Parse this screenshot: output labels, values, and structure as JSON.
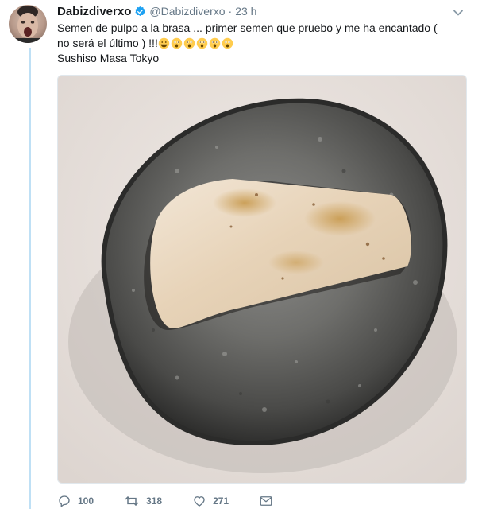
{
  "tweet": {
    "display_name": "Dabizdiverxo",
    "handle": "@Dabizdiverxo",
    "separator": "·",
    "time": "23 h",
    "text_line1": "Semen de pulpo a la brasa ... primer semen que pruebo y me ha encantado (",
    "text_line2": "no será el último ) !!!",
    "location_line": "Sushiso Masa Tokyo",
    "emojis": [
      "grinning-face-emoji",
      "astonished-face-emoji",
      "astonished-face-emoji",
      "astonished-face-emoji",
      "astonished-face-emoji",
      "astonished-face-emoji"
    ]
  },
  "actions": {
    "reply_count": "100",
    "retweet_count": "318",
    "like_count": "271"
  },
  "icons": {
    "verified": "verified-badge-icon",
    "caret": "chevron-down-icon",
    "reply": "reply-icon",
    "retweet": "retweet-icon",
    "like": "heart-icon",
    "dm": "envelope-icon"
  },
  "colors": {
    "accent": "#1da1f2",
    "thread_line": "#bfe0f5",
    "secondary_text": "#657786",
    "primary_text": "#14171a"
  }
}
